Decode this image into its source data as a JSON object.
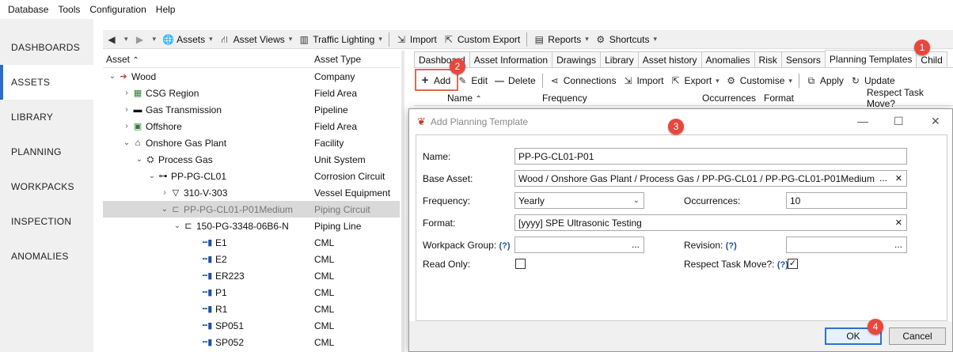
{
  "menu": [
    "Database",
    "Tools",
    "Configuration",
    "Help"
  ],
  "sidebar": [
    "DASHBOARDS",
    "ASSETS",
    "LIBRARY",
    "PLANNING",
    "WORKPACKS",
    "INSPECTION",
    "ANOMALIES"
  ],
  "toolbar": {
    "assets": "Assets",
    "asset_views": "Asset Views",
    "traffic": "Traffic Lighting",
    "import": "Import",
    "custom_export": "Custom Export",
    "reports": "Reports",
    "shortcuts": "Shortcuts"
  },
  "tree": {
    "col_asset": "Asset",
    "col_type": "Asset Type",
    "rows": [
      {
        "name": "Wood",
        "type": "Company"
      },
      {
        "name": "CSG Region",
        "type": "Field Area"
      },
      {
        "name": "Gas Transmission",
        "type": "Pipeline"
      },
      {
        "name": "Offshore",
        "type": "Field Area"
      },
      {
        "name": "Onshore Gas Plant",
        "type": "Facility"
      },
      {
        "name": "Process Gas",
        "type": "Unit System"
      },
      {
        "name": "PP-PG-CL01",
        "type": "Corrosion Circuit"
      },
      {
        "name": "310-V-303",
        "type": "Vessel Equipment"
      },
      {
        "name": "PP-PG-CL01-P01Medium",
        "type": "Piping Circuit"
      },
      {
        "name": "150-PG-3348-06B6-N",
        "type": "Piping Line"
      },
      {
        "name": "E1",
        "type": "CML"
      },
      {
        "name": "E2",
        "type": "CML"
      },
      {
        "name": "ER223",
        "type": "CML"
      },
      {
        "name": "P1",
        "type": "CML"
      },
      {
        "name": "R1",
        "type": "CML"
      },
      {
        "name": "SP051",
        "type": "CML"
      },
      {
        "name": "SP052",
        "type": "CML"
      }
    ]
  },
  "tabs": [
    "Dashboard",
    "Asset Information",
    "Drawings",
    "Library",
    "Asset history",
    "Anomalies",
    "Risk",
    "Sensors",
    "Planning Templates",
    "Child"
  ],
  "toolbar2": {
    "add": "Add",
    "edit": "Edit",
    "delete": "Delete",
    "connections": "Connections",
    "import": "Import",
    "export": "Export",
    "customise": "Customise",
    "apply": "Apply",
    "update": "Update"
  },
  "grid_cols": {
    "name": "Name",
    "frequency": "Frequency",
    "occurrences": "Occurrences",
    "format": "Format",
    "respect": "Respect Task Move?"
  },
  "badges": [
    "1",
    "2",
    "3",
    "4"
  ],
  "dialog": {
    "title": "Add Planning Template",
    "name_label": "Name:",
    "name": "PP-PG-CL01-P01",
    "base_label": "Base Asset:",
    "base": "Wood / Onshore Gas Plant / Process Gas / PP-PG-CL01 / PP-PG-CL01-P01Medium",
    "freq_label": "Frequency:",
    "freq": "Yearly",
    "occ_label": "Occurrences:",
    "occ": "10",
    "format_label": "Format:",
    "format": "[yyyy] SPE Ultrasonic Testing",
    "wp_label": "Workpack Group:",
    "rev_label": "Revision:",
    "ro_label": "Read Only:",
    "rtm_label": "Respect Task Move?:",
    "help": "(?)",
    "ellipsis": "...",
    "ok": "OK",
    "cancel": "Cancel"
  },
  "colors": {
    "accent": "#2b6cc4",
    "badge": "#e8473e"
  }
}
